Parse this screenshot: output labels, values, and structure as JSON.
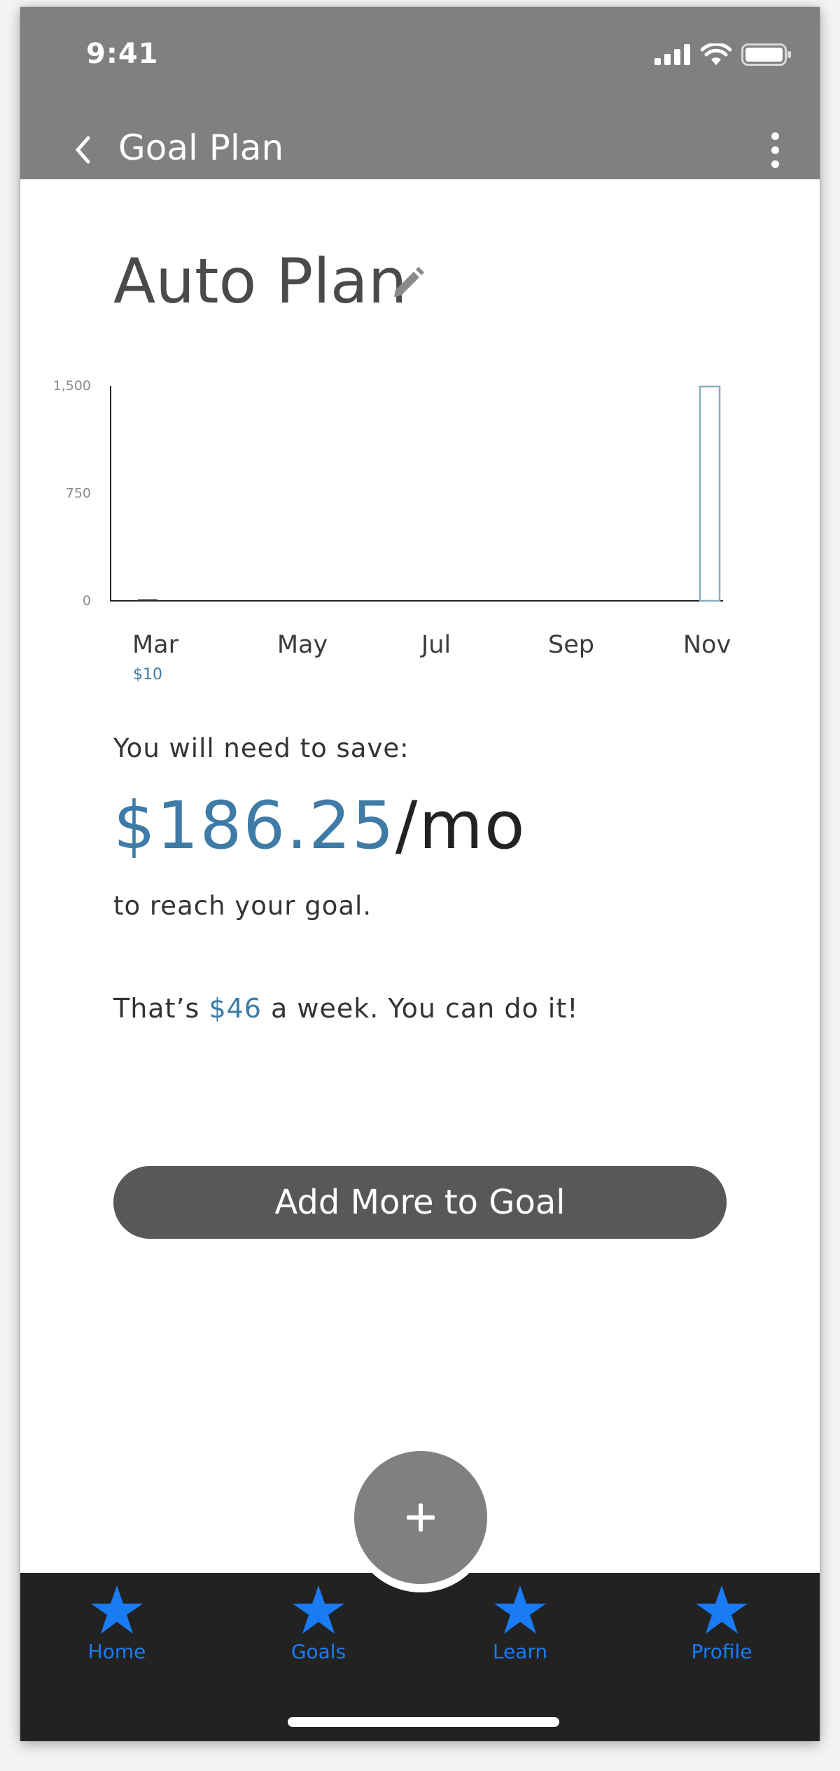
{
  "status_bar": {
    "time": "9:41"
  },
  "app_bar": {
    "title": "Goal Plan"
  },
  "plan": {
    "title": "Auto Plan"
  },
  "chart_data": {
    "type": "bar",
    "categories": [
      "Mar",
      "May",
      "Jul",
      "Sep",
      "Nov"
    ],
    "y_ticks": [
      "0",
      "750",
      "1,500"
    ],
    "ylim": [
      0,
      1500
    ],
    "series": [
      {
        "values": [
          10,
          0,
          0,
          0,
          0
        ],
        "style": "filled"
      },
      {
        "values": [
          0,
          0,
          0,
          0,
          1500
        ],
        "style": "outlined"
      }
    ],
    "data_labels": [
      {
        "category": "Mar",
        "text": "$10"
      }
    ],
    "colors": {
      "filled": "#2b2b2b",
      "outlined": "#8aaebe",
      "label": "#3e7ba6"
    }
  },
  "savings": {
    "lead": "You will need to save:",
    "amount": "$186.25",
    "unit": "/mo",
    "tail": "to reach your goal.",
    "week_prefix": "That’s ",
    "week_amount": "$46",
    "week_suffix": " a week. You can do it!"
  },
  "actions": {
    "add_more": "Add More to Goal",
    "fab": "+"
  },
  "tabs": [
    {
      "label": "Home",
      "icon": "star-icon"
    },
    {
      "label": "Goals",
      "icon": "star-icon"
    },
    {
      "label": "Learn",
      "icon": "star-icon"
    },
    {
      "label": "Profile",
      "icon": "star-icon"
    }
  ],
  "colors": {
    "accent": "#3e7ba6",
    "tab_active": "#1a7cf5",
    "header": "#808080",
    "tabbar": "#222222"
  }
}
